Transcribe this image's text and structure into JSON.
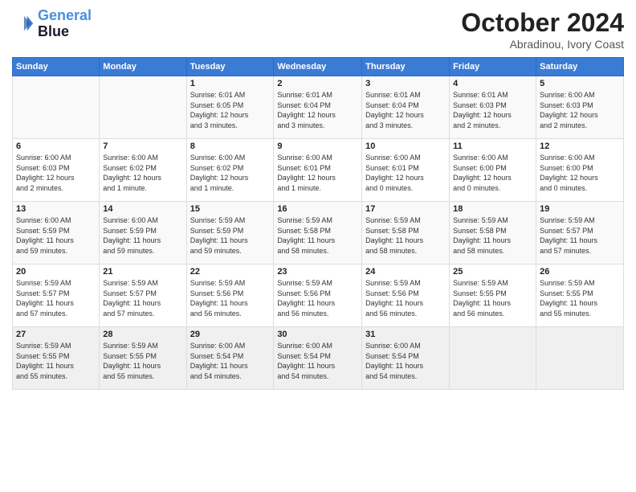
{
  "header": {
    "logo": {
      "line1": "General",
      "line2": "Blue"
    },
    "month": "October 2024",
    "location": "Abradinou, Ivory Coast"
  },
  "weekdays": [
    "Sunday",
    "Monday",
    "Tuesday",
    "Wednesday",
    "Thursday",
    "Friday",
    "Saturday"
  ],
  "weeks": [
    [
      {
        "day": "",
        "info": ""
      },
      {
        "day": "",
        "info": ""
      },
      {
        "day": "1",
        "info": "Sunrise: 6:01 AM\nSunset: 6:05 PM\nDaylight: 12 hours\nand 3 minutes."
      },
      {
        "day": "2",
        "info": "Sunrise: 6:01 AM\nSunset: 6:04 PM\nDaylight: 12 hours\nand 3 minutes."
      },
      {
        "day": "3",
        "info": "Sunrise: 6:01 AM\nSunset: 6:04 PM\nDaylight: 12 hours\nand 3 minutes."
      },
      {
        "day": "4",
        "info": "Sunrise: 6:01 AM\nSunset: 6:03 PM\nDaylight: 12 hours\nand 2 minutes."
      },
      {
        "day": "5",
        "info": "Sunrise: 6:00 AM\nSunset: 6:03 PM\nDaylight: 12 hours\nand 2 minutes."
      }
    ],
    [
      {
        "day": "6",
        "info": "Sunrise: 6:00 AM\nSunset: 6:03 PM\nDaylight: 12 hours\nand 2 minutes."
      },
      {
        "day": "7",
        "info": "Sunrise: 6:00 AM\nSunset: 6:02 PM\nDaylight: 12 hours\nand 1 minute."
      },
      {
        "day": "8",
        "info": "Sunrise: 6:00 AM\nSunset: 6:02 PM\nDaylight: 12 hours\nand 1 minute."
      },
      {
        "day": "9",
        "info": "Sunrise: 6:00 AM\nSunset: 6:01 PM\nDaylight: 12 hours\nand 1 minute."
      },
      {
        "day": "10",
        "info": "Sunrise: 6:00 AM\nSunset: 6:01 PM\nDaylight: 12 hours\nand 0 minutes."
      },
      {
        "day": "11",
        "info": "Sunrise: 6:00 AM\nSunset: 6:00 PM\nDaylight: 12 hours\nand 0 minutes."
      },
      {
        "day": "12",
        "info": "Sunrise: 6:00 AM\nSunset: 6:00 PM\nDaylight: 12 hours\nand 0 minutes."
      }
    ],
    [
      {
        "day": "13",
        "info": "Sunrise: 6:00 AM\nSunset: 5:59 PM\nDaylight: 11 hours\nand 59 minutes."
      },
      {
        "day": "14",
        "info": "Sunrise: 6:00 AM\nSunset: 5:59 PM\nDaylight: 11 hours\nand 59 minutes."
      },
      {
        "day": "15",
        "info": "Sunrise: 5:59 AM\nSunset: 5:59 PM\nDaylight: 11 hours\nand 59 minutes."
      },
      {
        "day": "16",
        "info": "Sunrise: 5:59 AM\nSunset: 5:58 PM\nDaylight: 11 hours\nand 58 minutes."
      },
      {
        "day": "17",
        "info": "Sunrise: 5:59 AM\nSunset: 5:58 PM\nDaylight: 11 hours\nand 58 minutes."
      },
      {
        "day": "18",
        "info": "Sunrise: 5:59 AM\nSunset: 5:58 PM\nDaylight: 11 hours\nand 58 minutes."
      },
      {
        "day": "19",
        "info": "Sunrise: 5:59 AM\nSunset: 5:57 PM\nDaylight: 11 hours\nand 57 minutes."
      }
    ],
    [
      {
        "day": "20",
        "info": "Sunrise: 5:59 AM\nSunset: 5:57 PM\nDaylight: 11 hours\nand 57 minutes."
      },
      {
        "day": "21",
        "info": "Sunrise: 5:59 AM\nSunset: 5:57 PM\nDaylight: 11 hours\nand 57 minutes."
      },
      {
        "day": "22",
        "info": "Sunrise: 5:59 AM\nSunset: 5:56 PM\nDaylight: 11 hours\nand 56 minutes."
      },
      {
        "day": "23",
        "info": "Sunrise: 5:59 AM\nSunset: 5:56 PM\nDaylight: 11 hours\nand 56 minutes."
      },
      {
        "day": "24",
        "info": "Sunrise: 5:59 AM\nSunset: 5:56 PM\nDaylight: 11 hours\nand 56 minutes."
      },
      {
        "day": "25",
        "info": "Sunrise: 5:59 AM\nSunset: 5:55 PM\nDaylight: 11 hours\nand 56 minutes."
      },
      {
        "day": "26",
        "info": "Sunrise: 5:59 AM\nSunset: 5:55 PM\nDaylight: 11 hours\nand 55 minutes."
      }
    ],
    [
      {
        "day": "27",
        "info": "Sunrise: 5:59 AM\nSunset: 5:55 PM\nDaylight: 11 hours\nand 55 minutes."
      },
      {
        "day": "28",
        "info": "Sunrise: 5:59 AM\nSunset: 5:55 PM\nDaylight: 11 hours\nand 55 minutes."
      },
      {
        "day": "29",
        "info": "Sunrise: 6:00 AM\nSunset: 5:54 PM\nDaylight: 11 hours\nand 54 minutes."
      },
      {
        "day": "30",
        "info": "Sunrise: 6:00 AM\nSunset: 5:54 PM\nDaylight: 11 hours\nand 54 minutes."
      },
      {
        "day": "31",
        "info": "Sunrise: 6:00 AM\nSunset: 5:54 PM\nDaylight: 11 hours\nand 54 minutes."
      },
      {
        "day": "",
        "info": ""
      },
      {
        "day": "",
        "info": ""
      }
    ]
  ]
}
